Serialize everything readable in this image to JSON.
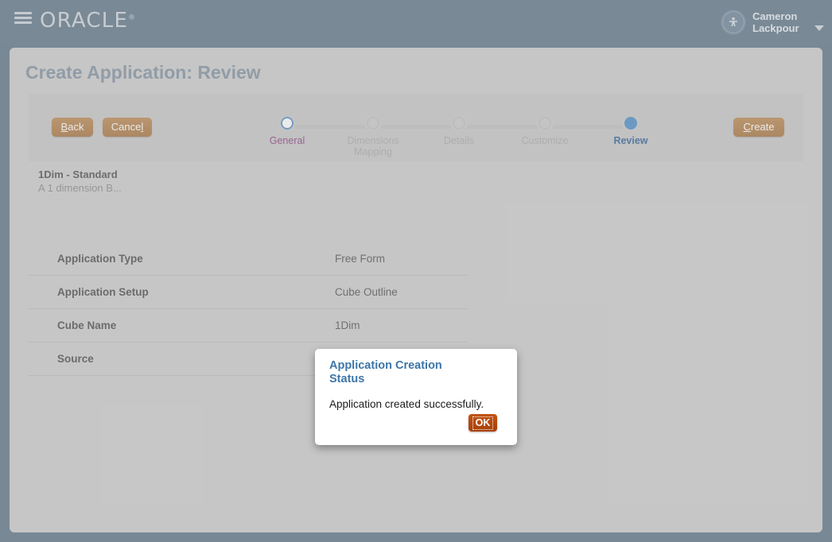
{
  "header": {
    "menu_icon": "hamburger-menu-icon",
    "brand": "ORACLE",
    "brand_mark": "®",
    "user_name_line1": "Cameron",
    "user_name_line2": "Lackpour",
    "avatar_icon": "person-icon",
    "caret_icon": "chevron-down-icon"
  },
  "page": {
    "title": "Create Application: Review"
  },
  "toolbar": {
    "back_label_pre": "",
    "back_label_mnemonic": "B",
    "back_label_post": "ack",
    "cancel_label_pre": "Cance",
    "cancel_label_mnemonic": "l",
    "cancel_label_post": "",
    "create_label_pre": "",
    "create_label_mnemonic": "C",
    "create_label_post": "reate"
  },
  "stepper": {
    "steps": [
      {
        "label": "General",
        "state": "visited"
      },
      {
        "label": "Dimensions Mapping",
        "state": "pending"
      },
      {
        "label": "Details",
        "state": "pending"
      },
      {
        "label": "Customize",
        "state": "pending"
      },
      {
        "label": "Review",
        "state": "current"
      }
    ]
  },
  "app_summary": {
    "name": "1Dim - Standard",
    "description": "A 1 dimension B..."
  },
  "review": {
    "rows": [
      {
        "label": "Application Type",
        "value": "Free Form"
      },
      {
        "label": "Application Setup",
        "value": "Cube Outline"
      },
      {
        "label": "Cube Name",
        "value": "1Dim"
      },
      {
        "label": "Source",
        "value": ""
      }
    ]
  },
  "dialog": {
    "title": "Application Creation Status",
    "message": "Application created successfully.",
    "ok_label": "OK"
  },
  "colors": {
    "header_bg": "#5c7386",
    "panel_bg": "#cbcbcb",
    "toolbar_bg": "#c4c4c4",
    "accent_blue": "#4a8ac4",
    "visited_purple": "#8a3c82",
    "current_blue": "#2c5f96",
    "button_tan": "#a4713c",
    "ok_orange": "#b5450b",
    "title_gray": "#7e8f9e"
  }
}
